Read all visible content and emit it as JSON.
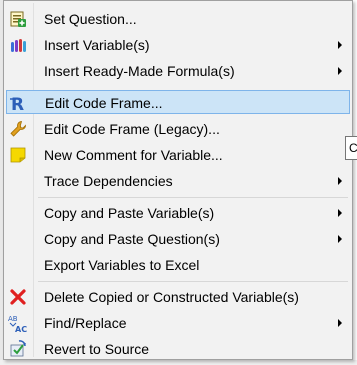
{
  "menu": {
    "items": [
      {
        "label": "Set Question...",
        "icon": "set-question-icon",
        "submenu": false
      },
      {
        "label": "Insert Variable(s)",
        "icon": "insert-variable-icon",
        "submenu": true
      },
      {
        "label": "Insert Ready-Made Formula(s)",
        "icon": "",
        "submenu": true
      },
      {
        "label": "Edit Code Frame...",
        "icon": "r-code-frame-icon",
        "submenu": false,
        "highlighted": true
      },
      {
        "label": "Edit Code Frame (Legacy)...",
        "icon": "wrench-icon",
        "submenu": false
      },
      {
        "label": "New Comment for Variable...",
        "icon": "sticky-note-icon",
        "submenu": false
      },
      {
        "label": "Trace Dependencies",
        "icon": "",
        "submenu": true
      },
      {
        "label": "Copy and Paste Variable(s)",
        "icon": "",
        "submenu": true
      },
      {
        "label": "Copy and Paste Question(s)",
        "icon": "",
        "submenu": true
      },
      {
        "label": "Export Variables to Excel",
        "icon": "",
        "submenu": false
      },
      {
        "label": "Delete Copied or Constructed Variable(s)",
        "icon": "red-x-icon",
        "submenu": false
      },
      {
        "label": "Find/Replace",
        "icon": "find-replace-icon",
        "submenu": true
      },
      {
        "label": "Revert to Source",
        "icon": "revert-icon",
        "submenu": false
      }
    ]
  },
  "tooltip_peek": {
    "text": "C"
  },
  "colors": {
    "menu_bg": "#f2f2f2",
    "highlight_bg": "#cce4f7",
    "highlight_border": "#7eb4ea",
    "separator": "#d7d7d7"
  }
}
